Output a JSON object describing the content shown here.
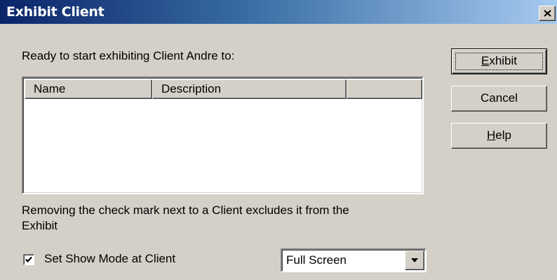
{
  "window": {
    "title": "Exhibit Client"
  },
  "intro_text": "Ready to start exhibiting Client Andre to:",
  "list": {
    "columns": [
      "Name",
      "Description",
      ""
    ],
    "rows": []
  },
  "hint_text_line1": "Removing the check mark next to a Client excludes it from the",
  "hint_text_line2": "Exhibit",
  "show_mode": {
    "label": "Set Show Mode at Client",
    "checked": true
  },
  "mode_select": {
    "value": "Full Screen"
  },
  "buttons": {
    "exhibit": {
      "mnemonic": "E",
      "rest": "xhibit"
    },
    "cancel": {
      "label": "Cancel"
    },
    "help": {
      "mnemonic": "H",
      "rest": "elp"
    }
  },
  "icons": {
    "close": "close-icon",
    "check": "checkmark-icon",
    "dropdown": "chevron-down-icon"
  }
}
